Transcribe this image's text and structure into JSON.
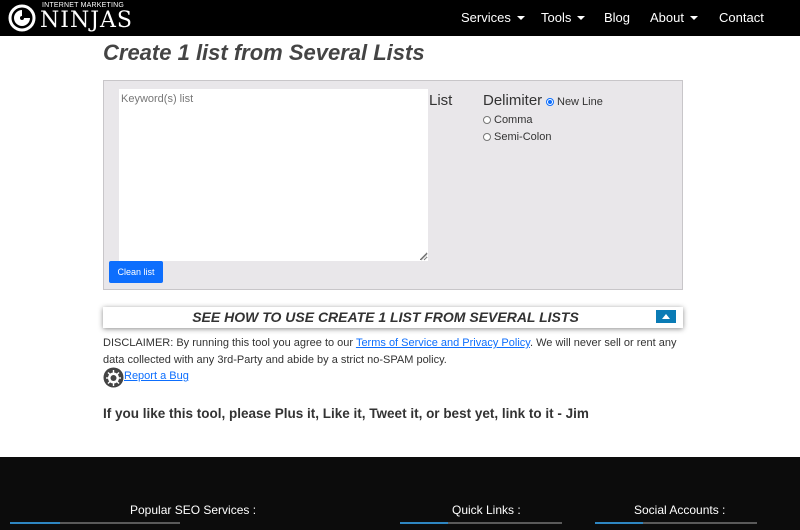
{
  "header": {
    "logo_small": "INTERNET MARKETING",
    "logo_big": "NINJAS",
    "nav": [
      {
        "label": "Services"
      },
      {
        "label": "Tools"
      },
      {
        "label": "Blog"
      },
      {
        "label": "About"
      },
      {
        "label": "Contact"
      }
    ]
  },
  "page": {
    "title": "Create 1 list from Several Lists"
  },
  "tool": {
    "keyword_placeholder": "Keyword(s) list",
    "list_label": "List",
    "delimiter_label": "Delimiter",
    "delimiters": [
      {
        "label": "New Line",
        "checked": true
      },
      {
        "label": "Comma",
        "checked": false
      },
      {
        "label": "Semi-Colon",
        "checked": false
      }
    ],
    "clean_button": "Clean list"
  },
  "howto": {
    "title": "SEE HOW TO USE CREATE 1 LIST FROM SEVERAL LISTS"
  },
  "disclaimer": {
    "prefix": "DISCLAIMER: By running this tool you agree to our ",
    "link": "Terms of Service and Privacy Policy",
    "suffix": ". We will never sell or rent any data collected with any 3rd-Party and abide by a strict no-SPAM policy."
  },
  "bug": {
    "label": "Report a Bug"
  },
  "plus_line": "If you like this tool, please Plus it, Like it, Tweet it, or best yet, link to it - Jim",
  "footer": {
    "popular_services": "Popular SEO Services :",
    "quick_links": "Quick Links :",
    "social_accounts": "Social Accounts :"
  },
  "colors": {
    "accent": "#0d6efd",
    "toggle": "#0a7bb5",
    "panel": "#e9e7ea",
    "footer": "#0c0c0c"
  }
}
